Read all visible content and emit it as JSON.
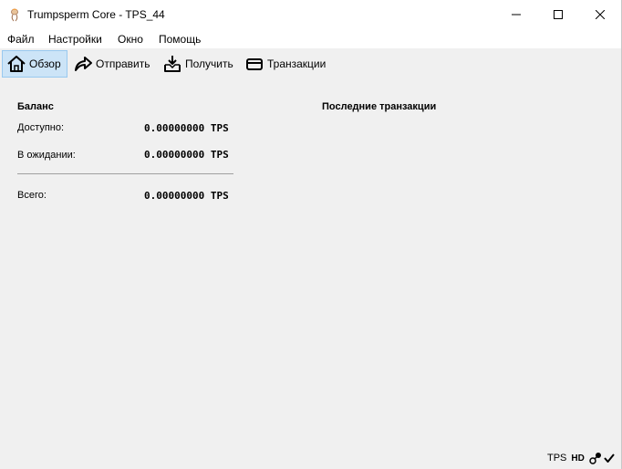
{
  "window": {
    "title": "Trumpsperm Core - TPS_44"
  },
  "menu": {
    "items": [
      "Файл",
      "Настройки",
      "Окно",
      "Помощь"
    ]
  },
  "toolbar": {
    "overview": "Обзор",
    "send": "Отправить",
    "receive": "Получить",
    "transactions": "Транзакции"
  },
  "balance": {
    "title": "Баланс",
    "available_label": "Доступно:",
    "available_value": "0.00000000 TPS",
    "pending_label": "В ожидании:",
    "pending_value": "0.00000000 TPS",
    "total_label": "Всего:",
    "total_value": "0.00000000 TPS"
  },
  "recent": {
    "title": "Последние транзакции"
  },
  "status": {
    "unit": "TPS",
    "hd": "HD",
    "icons": [
      "hd-wallet-icon",
      "network-activity-icon",
      "sync-complete-icon"
    ]
  }
}
